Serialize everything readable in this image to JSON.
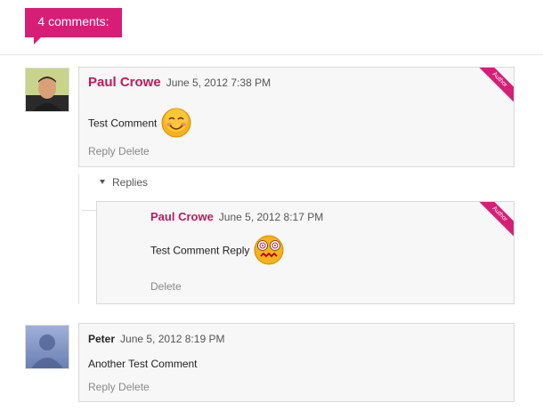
{
  "comments_header": {
    "count_label": "4 comments:"
  },
  "comments": [
    {
      "author": "Paul Crowe",
      "date": "June 5, 2012 7:38 PM",
      "text": "Test Comment",
      "ribbon": "Author",
      "actions": {
        "reply": "Reply",
        "delete": "Delete"
      },
      "emoji": "smiling-emoji-icon"
    },
    {
      "author": "Peter",
      "date": "June 5, 2012 8:19 PM",
      "text": "Another Test Comment",
      "actions": {
        "reply": "Reply",
        "delete": "Delete"
      }
    }
  ],
  "replies_toggle": "Replies",
  "reply": {
    "author": "Paul Crowe",
    "date": "June 5, 2012 8:17 PM",
    "text": "Test Comment Reply",
    "ribbon": "Author",
    "actions": {
      "delete": "Delete"
    },
    "emoji": "dizzy-emoji-icon"
  },
  "colors": {
    "accent": "#d61e77",
    "author_link": "#c2185b",
    "box_bg": "#f7f7f7"
  }
}
